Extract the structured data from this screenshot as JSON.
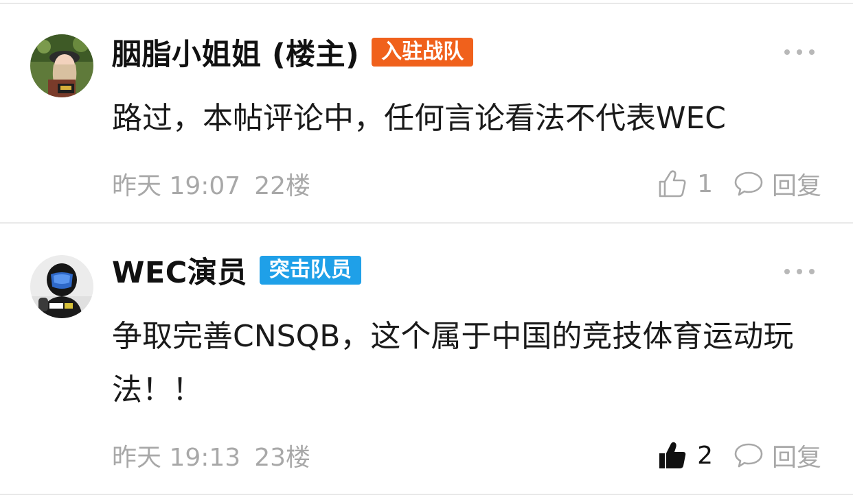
{
  "colors": {
    "owner_badge": "#f0611c",
    "member_badge": "#1fa0e8",
    "muted_text": "#a8a8a8",
    "liked_icon": "#111111",
    "unliked_icon": "#a8a8a8"
  },
  "comments": [
    {
      "username": "胭脂小姐姐 (楼主)",
      "badge": "入驻战队",
      "badge_style": "owner",
      "content": "路过，本帖评论中，任何言论看法不代表WEC",
      "date": "昨天 19:07",
      "floor": "22楼",
      "likes": "1",
      "liked": false,
      "reply_label": "回复",
      "avatar_icon": "user-avatar-photo"
    },
    {
      "username": "WEC演员",
      "badge": "突击队员",
      "badge_style": "member",
      "content": "争取完善CNSQB，这个属于中国的竞技体育运动玩法！！",
      "date": "昨天 19:13",
      "floor": "23楼",
      "likes": "2",
      "liked": true,
      "reply_label": "回复",
      "avatar_icon": "user-avatar-photo"
    }
  ]
}
